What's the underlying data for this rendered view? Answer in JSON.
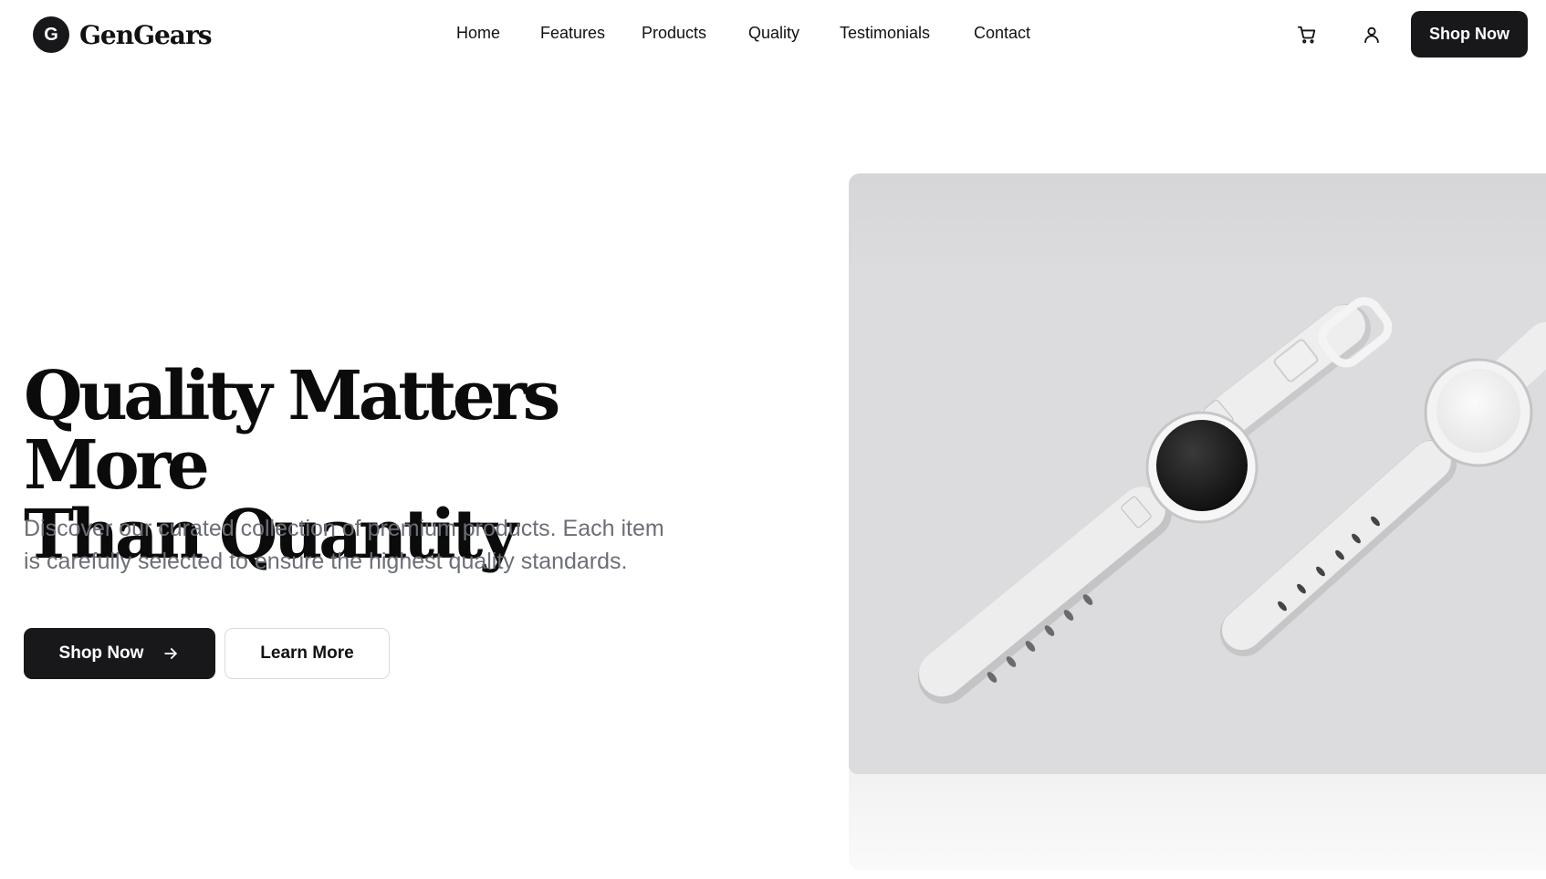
{
  "brand": {
    "logo_letter": "G",
    "name": "GenGears"
  },
  "nav": {
    "items": [
      {
        "label": "Home"
      },
      {
        "label": "Features"
      },
      {
        "label": "Products"
      },
      {
        "label": "Quality"
      },
      {
        "label": "Testimonials"
      },
      {
        "label": "Contact"
      }
    ]
  },
  "header_actions": {
    "cart_icon": "shopping-cart-icon",
    "account_icon": "user-icon",
    "cta_label": "Shop Now"
  },
  "hero": {
    "title_line1": "Quality Matters More",
    "title_line2": "Than Quantity",
    "subtitle": "Discover our curated collection of premium products. Each item is carefully selected to ensure the highest quality standards.",
    "primary_button": {
      "label": "Shop Now",
      "icon": "arrow-right-icon"
    },
    "secondary_button": {
      "label": "Learn More"
    }
  },
  "colors": {
    "primary": "#18181b",
    "text": "#111111",
    "muted_text": "#6b6f76",
    "background": "#ffffff",
    "image_backdrop": "#dcdbdd"
  }
}
